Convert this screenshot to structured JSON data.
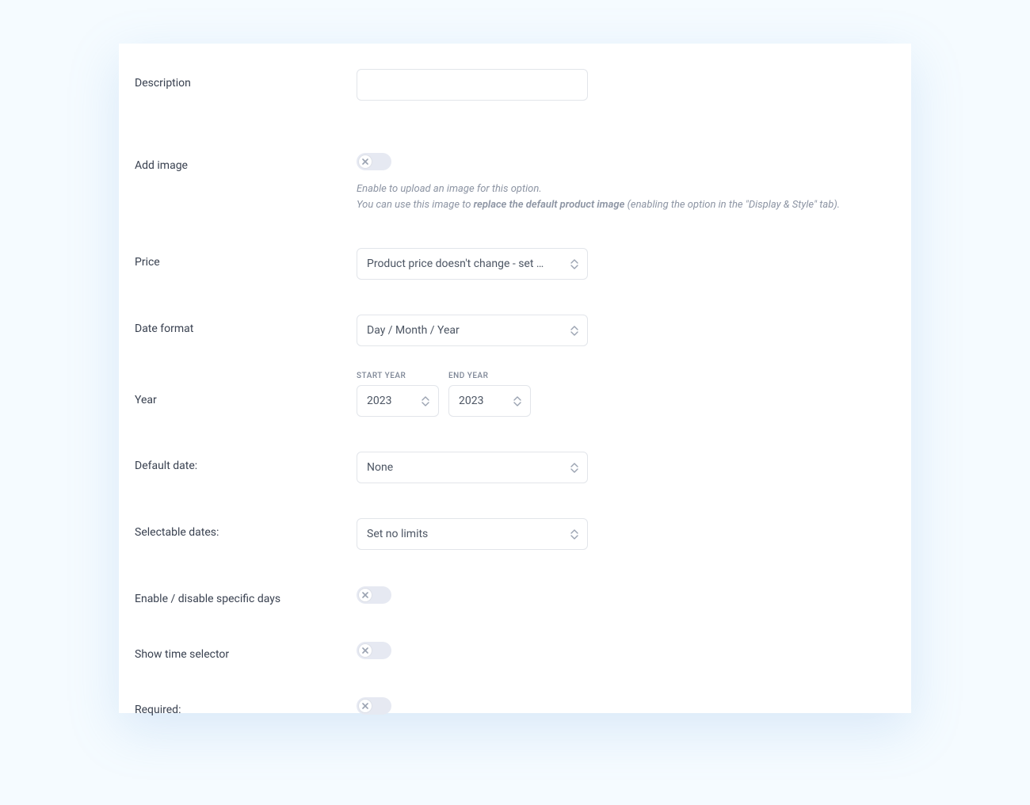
{
  "form": {
    "description": {
      "label": "Description",
      "value": ""
    },
    "add_image": {
      "label": "Add image",
      "enabled": false,
      "help_line1": "Enable to upload an image for this option.",
      "help_line2_pre": "You can use this image to ",
      "help_line2_strong": "replace the default product image",
      "help_line2_post": " (enabling the option in the \"Display & Style\" tab)."
    },
    "price": {
      "label": "Price",
      "selected": "Product price doesn't change - set …"
    },
    "date_format": {
      "label": "Date format",
      "selected": "Day / Month / Year"
    },
    "year": {
      "label": "Year",
      "start_label": "START YEAR",
      "start_value": "2023",
      "end_label": "END YEAR",
      "end_value": "2023"
    },
    "default_date": {
      "label": "Default date:",
      "selected": "None"
    },
    "selectable_dates": {
      "label": "Selectable dates:",
      "selected": "Set no limits"
    },
    "enable_specific_days": {
      "label": "Enable / disable specific days",
      "enabled": false
    },
    "show_time": {
      "label": "Show time selector",
      "enabled": false
    },
    "required": {
      "label": "Required:",
      "enabled": false
    }
  }
}
